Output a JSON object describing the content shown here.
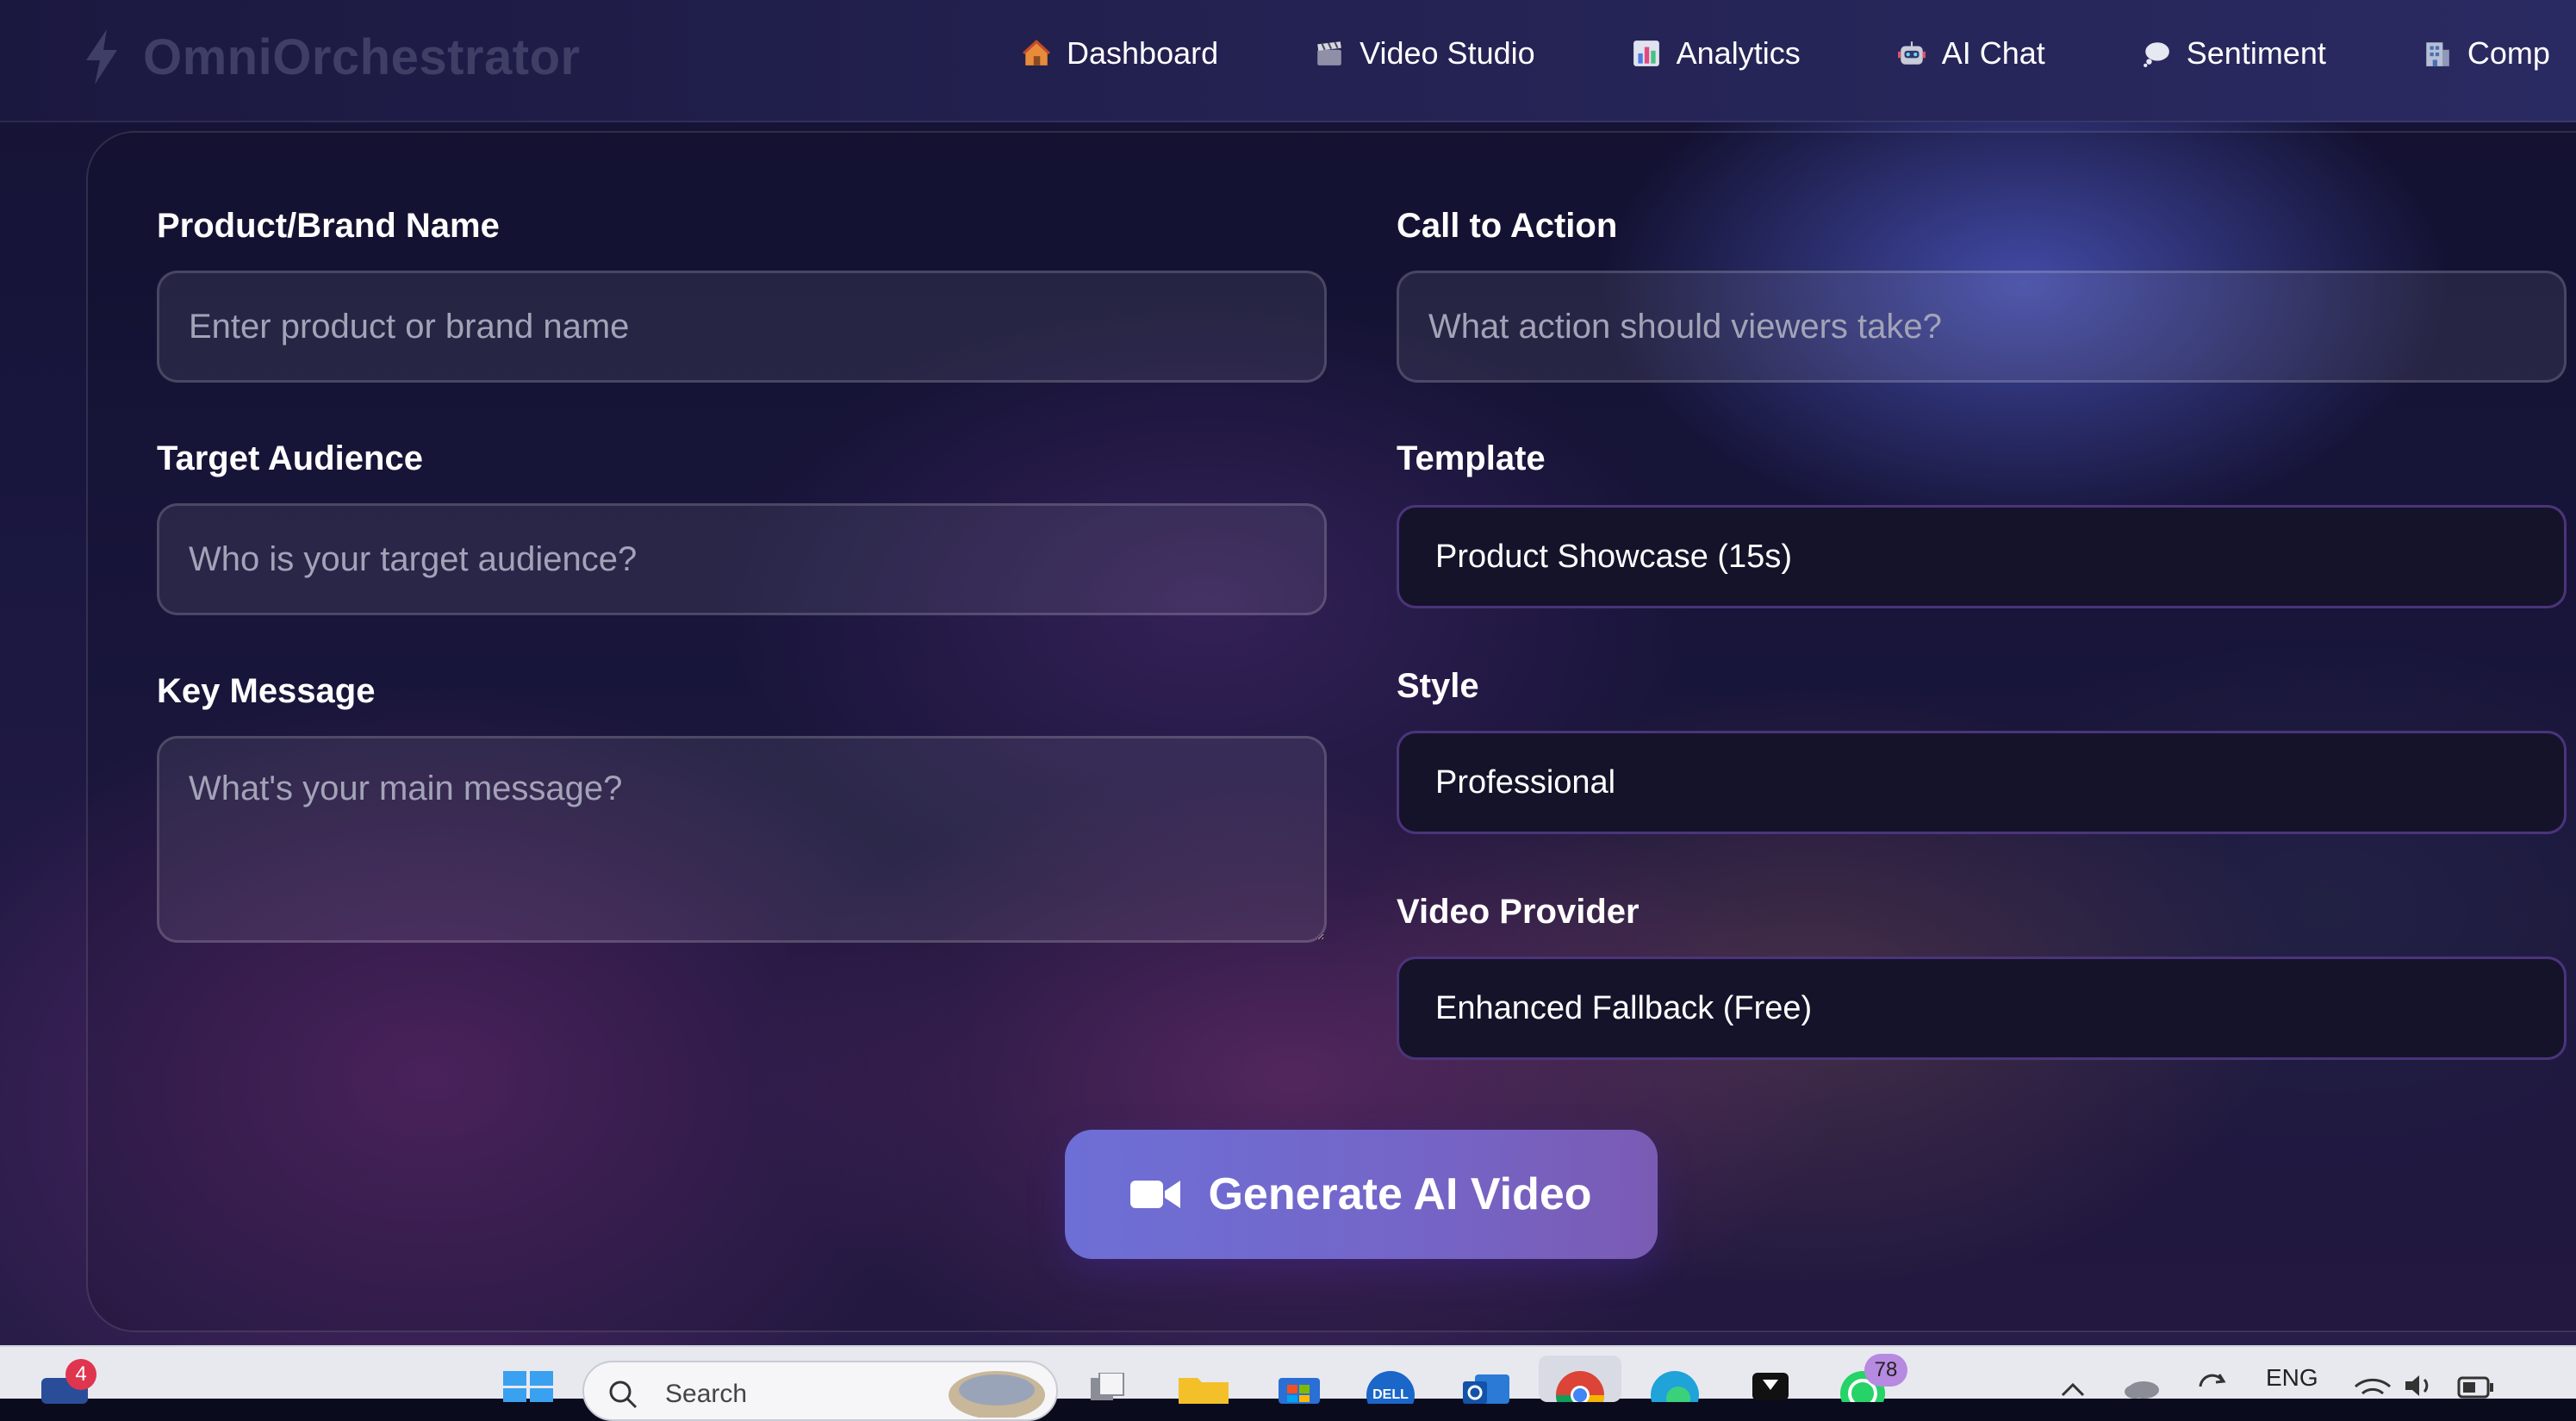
{
  "app": {
    "name": "OmniOrchestrator"
  },
  "nav": {
    "items": [
      {
        "label": "Dashboard",
        "icon": "house-icon"
      },
      {
        "label": "Video Studio",
        "icon": "clapperboard-icon"
      },
      {
        "label": "Analytics",
        "icon": "bar-chart-icon"
      },
      {
        "label": "AI Chat",
        "icon": "robot-icon"
      },
      {
        "label": "Sentiment",
        "icon": "speech-bubble-icon"
      },
      {
        "label": "Comp",
        "icon": "building-icon"
      }
    ]
  },
  "form": {
    "product": {
      "label": "Product/Brand Name",
      "placeholder": "Enter product or brand name"
    },
    "audience": {
      "label": "Target Audience",
      "placeholder": "Who is your target audience?"
    },
    "message": {
      "label": "Key Message",
      "placeholder": "What's your main message?"
    },
    "cta": {
      "label": "Call to Action",
      "placeholder": "What action should viewers take?"
    },
    "template": {
      "label": "Template",
      "value": "Product Showcase (15s)"
    },
    "style": {
      "label": "Style",
      "value": "Professional"
    },
    "provider": {
      "label": "Video Provider",
      "value": "Enhanced Fallback (Free)"
    },
    "generate_label": "Generate AI Video"
  },
  "taskbar": {
    "search_label": "Search",
    "notification_count": "4",
    "whatsapp_count": "78",
    "language": "ENG"
  },
  "colors": {
    "accent_start": "#6d6fd6",
    "accent_end": "#7a5bb4",
    "select_bg": "#15132a"
  }
}
